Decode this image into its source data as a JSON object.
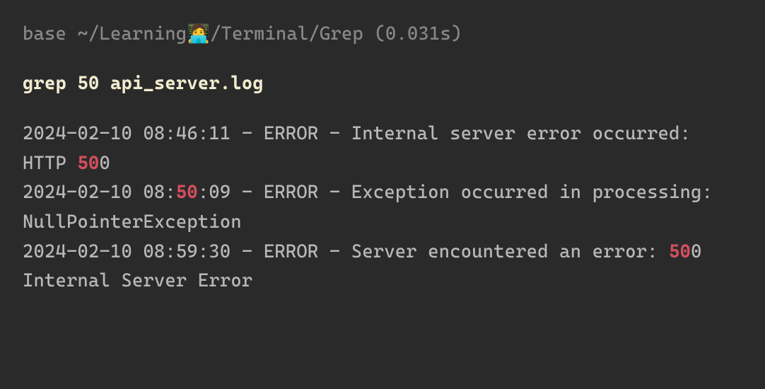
{
  "prompt": {
    "env": "base",
    "path_prefix": " ~/Learning",
    "emoji": "🧑‍💻",
    "path_suffix": "/Terminal/Grep ",
    "timing": "(0.031s)"
  },
  "command": "grep 50 api_server.log",
  "output": {
    "line1_a": "2024-02-10 08:46:11 - ERROR - Internal server error occurred: HTTP ",
    "line1_hl": "50",
    "line1_b": "0",
    "line2_a": "2024-02-10 08:",
    "line2_hl": "50",
    "line2_b": ":09 - ERROR - Exception occurred in processing: NullPointerException",
    "line3_a": "2024-02-10 08:59:30 - ERROR - Server encountered an error: ",
    "line3_hl": "50",
    "line3_b": "0 Internal Server Error"
  }
}
